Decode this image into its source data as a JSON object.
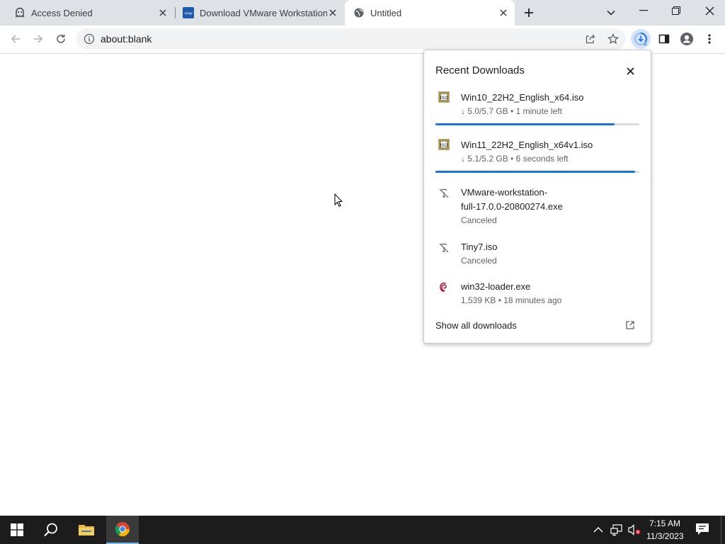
{
  "tabs": [
    {
      "title": "Access Denied",
      "icon": "ghost-icon"
    },
    {
      "title": "Download VMware Workstation Pro",
      "icon": "vmware-icon"
    },
    {
      "title": "Untitled",
      "icon": "globe-icon"
    }
  ],
  "toolbar": {
    "url": "about:blank",
    "downloads_badge": "2"
  },
  "downloads": {
    "title": "Recent Downloads",
    "items": [
      {
        "name": "Win10_22H2_English_x64.iso",
        "status": "↓ 5.0/5.7 GB • 1 minute left",
        "progress": 0.88,
        "icon": "iso-file-icon"
      },
      {
        "name": "Win11_22H2_English_x64v1.iso",
        "status": "↓ 5.1/5.2 GB • 6 seconds left",
        "progress": 0.98,
        "icon": "iso-file-icon"
      },
      {
        "name_line1": "VMware-workstation-",
        "name_line2": "full-17.0.0-20800274.exe",
        "status": "Canceled",
        "icon": "canceled-file-icon"
      },
      {
        "name": "Tiny7.iso",
        "status": "Canceled",
        "icon": "canceled-file-icon"
      },
      {
        "name": "win32-loader.exe",
        "status": "1,539 KB • 18 minutes ago",
        "icon": "debian-icon"
      }
    ],
    "show_all": "Show all downloads"
  },
  "taskbar": {
    "time": "7:15 AM",
    "date": "11/3/2023"
  },
  "colors": {
    "accent": "#1a73e8",
    "tabstrip": "#dee1e6",
    "taskbar": "#1c1c1c"
  }
}
